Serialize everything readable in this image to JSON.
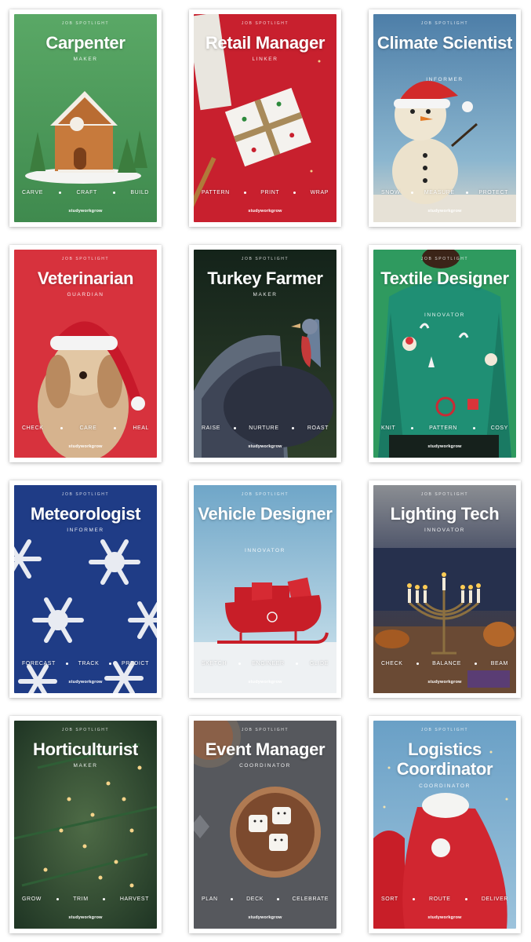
{
  "cards": [
    {
      "spotlight": "JOB SPOTLIGHT",
      "title": "Carpenter",
      "role": "MAKER",
      "verbs": [
        "CARVE",
        "CRAFT",
        "BUILD"
      ],
      "brand": "studyworkgrow",
      "bg": "#4e9b5c",
      "image": "gingerbread-house-icon"
    },
    {
      "spotlight": "JOB SPOTLIGHT",
      "title": "Retail Manager",
      "role": "LINKER",
      "verbs": [
        "PATTERN",
        "PRINT",
        "WRAP"
      ],
      "brand": "studyworkgrow",
      "bg": "#c8202e",
      "image": "wrapped-gift-icon"
    },
    {
      "spotlight": "JOB SPOTLIGHT",
      "title": "Climate Scientist",
      "role": "INFORMER",
      "verbs": [
        "SNOW",
        "MEASURE",
        "PROTECT"
      ],
      "brand": "studyworkgrow",
      "bg": "#5f8eb3",
      "image": "snowman-icon"
    },
    {
      "spotlight": "JOB SPOTLIGHT",
      "title": "Veterinarian",
      "role": "GUARDIAN",
      "verbs": [
        "CHECK",
        "CARE",
        "HEAL"
      ],
      "brand": "studyworkgrow",
      "bg": "#d7323d",
      "image": "dog-santa-hat-icon"
    },
    {
      "spotlight": "JOB SPOTLIGHT",
      "title": "Turkey Farmer",
      "role": "MAKER",
      "verbs": [
        "RAISE",
        "NURTURE",
        "ROAST"
      ],
      "brand": "studyworkgrow",
      "bg": "#1b2c1b",
      "image": "turkey-icon"
    },
    {
      "spotlight": "JOB SPOTLIGHT",
      "title": "Textile Designer",
      "role": "INNOVATOR",
      "verbs": [
        "KNIT",
        "PATTERN",
        "COSY"
      ],
      "brand": "studyworkgrow",
      "bg": "#2e9960",
      "image": "christmas-sweater-icon"
    },
    {
      "spotlight": "JOB SPOTLIGHT",
      "title": "Meteorologist",
      "role": "INFORMER",
      "verbs": [
        "FORECAST",
        "TRACK",
        "PREDICT"
      ],
      "brand": "studyworkgrow",
      "bg": "#1f3c86",
      "image": "snowflake-icon"
    },
    {
      "spotlight": "JOB SPOTLIGHT",
      "title": "Vehicle Designer",
      "role": "INNOVATOR",
      "verbs": [
        "SKETCH",
        "ENGINEER",
        "GLIDE"
      ],
      "brand": "studyworkgrow",
      "bg": "#8fbcd4",
      "image": "sleigh-icon"
    },
    {
      "spotlight": "JOB SPOTLIGHT",
      "title": "Lighting Tech",
      "role": "INNOVATOR",
      "verbs": [
        "CHECK",
        "BALANCE",
        "BEAM"
      ],
      "brand": "studyworkgrow",
      "bg": "#3c4a6e",
      "image": "menorah-icon"
    },
    {
      "spotlight": "JOB SPOTLIGHT",
      "title": "Horticulturist",
      "role": "MAKER",
      "verbs": [
        "GROW",
        "TRIM",
        "HARVEST"
      ],
      "brand": "studyworkgrow",
      "bg": "#2f4f2f",
      "image": "pine-branch-lights-icon"
    },
    {
      "spotlight": "JOB SPOTLIGHT",
      "title": "Event Manager",
      "role": "COORDINATOR",
      "verbs": [
        "PLAN",
        "DECK",
        "CELEBRATE"
      ],
      "brand": "studyworkgrow",
      "bg": "#55575c",
      "image": "hot-chocolate-icon"
    },
    {
      "spotlight": "JOB SPOTLIGHT",
      "title": "Logistics Coordinator",
      "role": "COORDINATOR",
      "verbs": [
        "SORT",
        "ROUTE",
        "DELIVER"
      ],
      "brand": "studyworkgrow",
      "bg": "#7fb0d2",
      "image": "santa-sack-icon"
    }
  ]
}
